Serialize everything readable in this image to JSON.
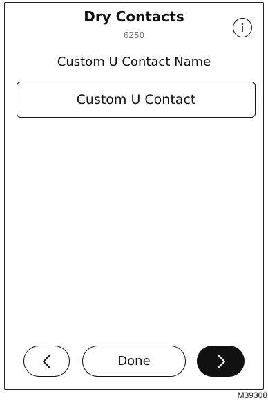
{
  "header": {
    "title": "Dry Contacts",
    "subtitle": "6250",
    "info_icon": "info-icon"
  },
  "form": {
    "label": "Custom U Contact Name",
    "value": "Custom U Contact"
  },
  "footer": {
    "back_icon": "chevron-left-icon",
    "done_label": "Done",
    "next_icon": "chevron-right-icon"
  },
  "figure_id": "M39308"
}
